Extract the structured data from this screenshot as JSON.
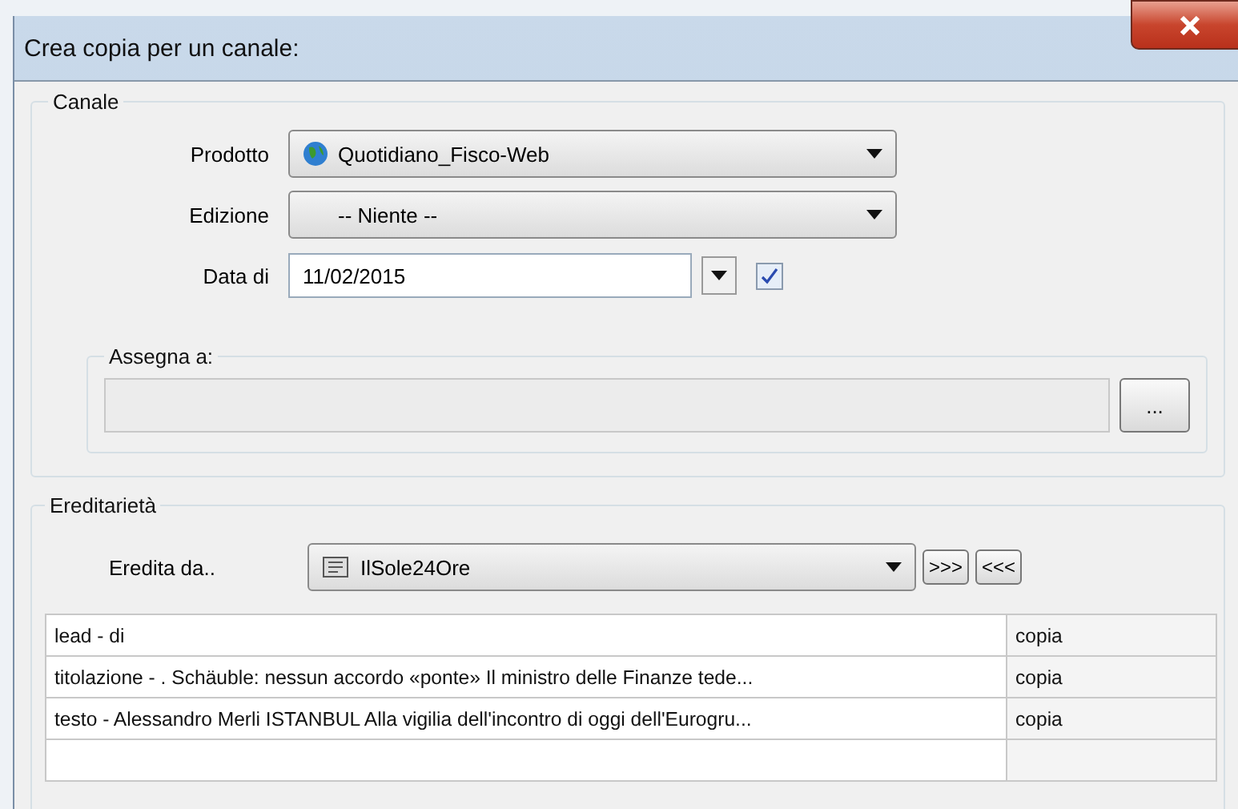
{
  "window": {
    "title": "Crea copia per un canale:"
  },
  "canale": {
    "legend": "Canale",
    "prodotto": {
      "label": "Prodotto",
      "value": "Quotidiano_Fisco-Web"
    },
    "edizione": {
      "label": "Edizione",
      "value": "-- Niente --"
    },
    "data": {
      "label": "Data di",
      "value": "11/02/2015",
      "checked": true
    },
    "assegna": {
      "legend": "Assegna a:",
      "button": "..."
    }
  },
  "ereditarieta": {
    "legend": "Ereditarietà",
    "label": "Eredita da..",
    "value": "IlSole24Ore",
    "buttons": [
      ">>>",
      "<<<"
    ],
    "rows": [
      {
        "name": "lead - di",
        "action": "copia"
      },
      {
        "name": "titolazione - . Schäuble: nessun accordo «ponte» Il ministro delle Finanze tede...",
        "action": "copia"
      },
      {
        "name": "testo - Alessandro Merli ISTANBUL Alla vigilia dell'incontro di oggi dell'Eurogru...",
        "action": "copia"
      }
    ]
  }
}
